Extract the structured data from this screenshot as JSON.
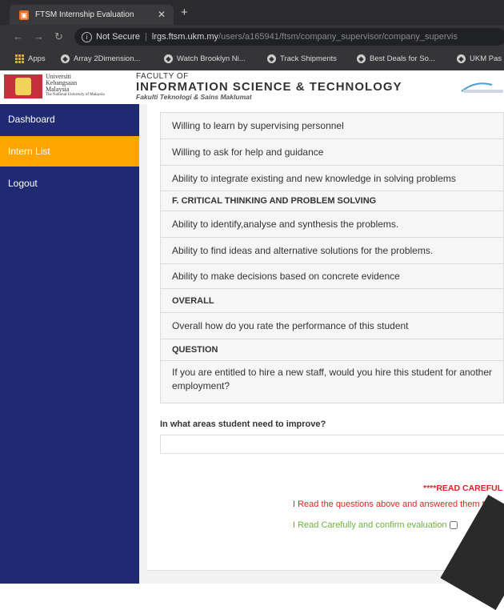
{
  "browser": {
    "tab_title": "FTSM Internship Evaluation",
    "url_security": "Not Secure",
    "url_domain": "lrgs.ftsm.ukm.my",
    "url_path": "/users/a165941/ftsm/company_supervisor/company_supervis",
    "bookmarks": [
      "Apps",
      "Array 2Dimension...",
      "Watch Brooklyn Ni...",
      "Track Shipments",
      "Best Deals for So...",
      "UKM Pas"
    ]
  },
  "header": {
    "ukm_line1": "Universiti",
    "ukm_line2": "Kebangsaan",
    "ukm_line3": "Malaysia",
    "ukm_line4": "The National University of Malaysia",
    "faculty_line1": "FACULTY OF",
    "faculty_line2": "INFORMATION SCIENCE & TECHNOLOGY",
    "faculty_line3": "Fakulti Teknologi & Sains Maklumat"
  },
  "sidebar": {
    "items": [
      {
        "label": "Dashboard",
        "active": false
      },
      {
        "label": "Intern List",
        "active": true
      },
      {
        "label": "Logout",
        "active": false
      }
    ]
  },
  "evaluation": {
    "rows": [
      "Willing to learn by supervising personnel",
      "Willing to ask for help and guidance",
      "Ability to integrate existing and new knowledge in solving problems",
      "F.  CRITICAL THINKING AND PROBLEM SOLVING",
      "Ability to identify,analyse and synthesis the problems.",
      "Ability to find ideas and alternative solutions for the problems.",
      "Ability to make decisions based on concrete evidence",
      "OVERALL",
      "Overall how do you rate the performance of this student",
      "QUESTION",
      "If you are entitled to hire a new staff, would you hire this student for another employment?"
    ],
    "improve_label": "In what areas student need to improve?",
    "improve_value": "",
    "warning_title": "****READ CAREFUL",
    "warning_text": "I Read the questions above and answered them thor",
    "confirm_label": "I Read Carefully and confirm evaluation"
  }
}
